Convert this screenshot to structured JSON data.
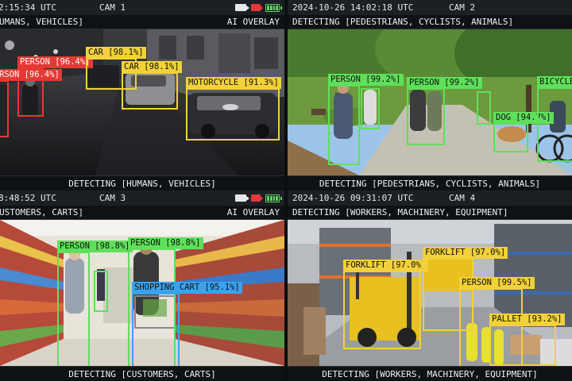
{
  "colors": {
    "person_red": "#e53935",
    "vehicle_yellow": "#f2d13a",
    "person_green": "#5fe05a",
    "cart_blue": "#3aa3ee",
    "battery_green": "#5fd35f",
    "rec_red": "#e03a3a"
  },
  "cameras": [
    {
      "timestamp": "2:15:34 UTC",
      "label": "CAM 1",
      "subheader_left": "UMANS, VEHICLES]",
      "subheader_right": "AI OVERLAY",
      "footer": "DETECTING [HUMANS, VEHICLES]",
      "icons": [
        "video-camera-icon",
        "record-icon",
        "battery-icon"
      ],
      "detections": [
        {
          "label": "PERSON [96.4%]",
          "class": "person"
        },
        {
          "label": "RSON [96.4%]",
          "class": "person"
        },
        {
          "label": "CAR [98.1%]",
          "class": "vehicle"
        },
        {
          "label": "CAR [98.1%]",
          "class": "vehicle"
        },
        {
          "label": "MOTORCYCLE [91.3%]",
          "class": "vehicle"
        }
      ]
    },
    {
      "timestamp": "2024-10-26 14:02:18 UTC",
      "label": "CAM 2",
      "subheader_left": "DETECTING [PEDESTRIANS, CYCLISTS, ANIMALS]",
      "subheader_right": "",
      "footer": "DETECTING [PEDESTRIANS, CYCLISTS, ANIMALS]",
      "icons": [],
      "detections": [
        {
          "label": "PERSON [99.2%]",
          "class": "person"
        },
        {
          "label": "PERSON [99.2%]",
          "class": "person"
        },
        {
          "label": "DOG [94.7%]",
          "class": "animal"
        },
        {
          "label": "BICYCLE",
          "class": "cyclist"
        }
      ]
    },
    {
      "timestamp": "8:48:52 UTC",
      "label": "CAM 3",
      "subheader_left": "USTOMERS, CARTS]",
      "subheader_right": "AI OVERLAY",
      "footer": "DETECTING [CUSTOMERS, CARTS]",
      "icons": [
        "video-camera-icon",
        "record-icon",
        "battery-icon"
      ],
      "detections": [
        {
          "label": "PERSON [98.8%]",
          "class": "person"
        },
        {
          "label": "PERSON [98.8%]",
          "class": "person"
        },
        {
          "label": "SHOPPING CART [95.1%]",
          "class": "cart"
        }
      ]
    },
    {
      "timestamp": "2024-10-26 09:31:07 UTC",
      "label": "CAM 4",
      "subheader_left": "DETECTING [WORKERS, MACHINERY, EQUIPMENT]",
      "subheader_right": "",
      "footer": "DETECTING [WORKERS, MACHINERY, EQUIPMENT]",
      "icons": [],
      "detections": [
        {
          "label": "FORKLIFT [97.0%]",
          "class": "machinery"
        },
        {
          "label": "FORKLIFT [97.0%]",
          "class": "machinery"
        },
        {
          "label": "PERSON [99.5%]",
          "class": "person"
        },
        {
          "label": "PALLET [93.2%]",
          "class": "equipment"
        }
      ]
    }
  ]
}
